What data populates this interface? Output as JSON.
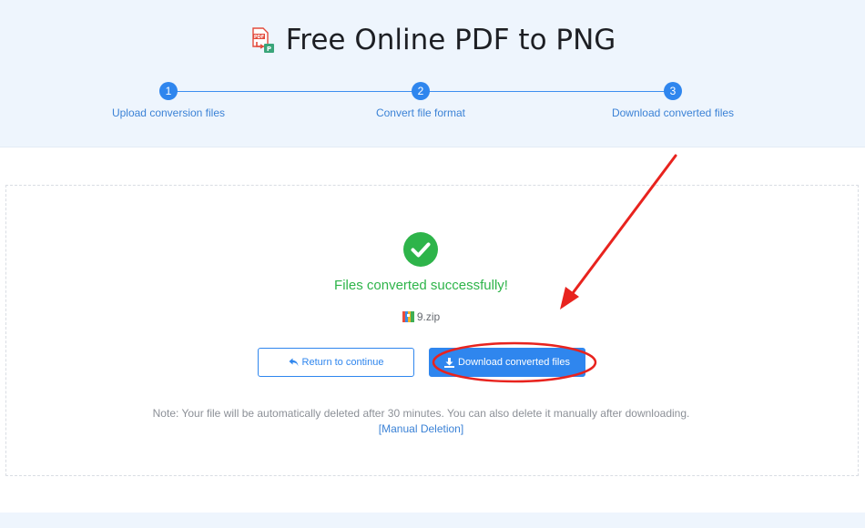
{
  "header": {
    "title": "Free Online PDF to PNG",
    "title_icon": "pdf-to-png-icon"
  },
  "steps": [
    {
      "number": "1",
      "label": "Upload conversion files"
    },
    {
      "number": "2",
      "label": "Convert file format"
    },
    {
      "number": "3",
      "label": "Download converted files"
    }
  ],
  "result": {
    "status_icon": "check-circle-icon",
    "message": "Files converted successfully!",
    "file_name": "9.zip",
    "file_icon": "zip-file-icon"
  },
  "buttons": {
    "return_label": "Return to continue",
    "return_icon": "reply-arrow-icon",
    "download_label": "Download converted files",
    "download_icon": "download-icon"
  },
  "note": {
    "text": "Note: Your file will be automatically deleted after 30 minutes. You can also delete it manually after downloading.",
    "link": "[Manual Deletion]"
  },
  "colors": {
    "accent": "#2f86ee",
    "success": "#2eb44a",
    "header_bg": "#eef5fd",
    "annotation": "#e8231e"
  }
}
